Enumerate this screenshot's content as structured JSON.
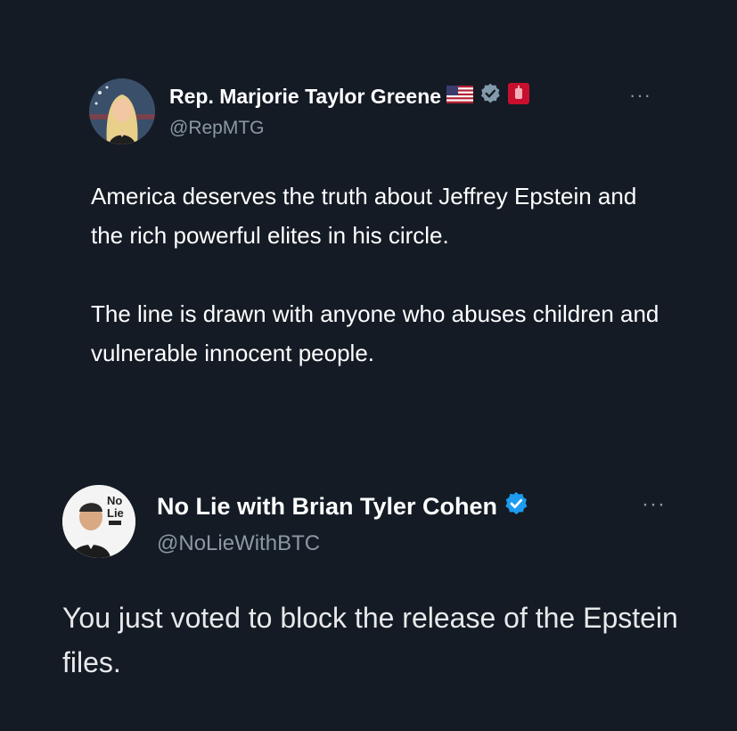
{
  "tweets": [
    {
      "author": {
        "name": "Rep. Marjorie Taylor Greene",
        "handle": "@RepMTG",
        "badges": [
          "us-flag-icon",
          "verified-gray-icon",
          "government-affiliation-icon"
        ]
      },
      "more_label": "···",
      "text": [
        "America deserves the truth about Jeffrey Epstein and the rich powerful elites in his circle.",
        "The line is drawn with anyone who abuses children and vulnerable innocent people."
      ]
    },
    {
      "author": {
        "name": "No Lie with Brian Tyler Cohen",
        "handle": "@NoLieWithBTC",
        "avatar_text": "No Lie",
        "badges": [
          "verified-blue-icon"
        ]
      },
      "more_label": "···",
      "text": [
        "You just voted to block the release of the Epstein files."
      ]
    }
  ],
  "colors": {
    "background": "#141b25",
    "text_primary": "#ffffff",
    "text_secondary": "#8b98a5",
    "verified_blue": "#1d9bf0",
    "verified_gray": "#829aab",
    "gov_badge_red": "#c8102e"
  }
}
